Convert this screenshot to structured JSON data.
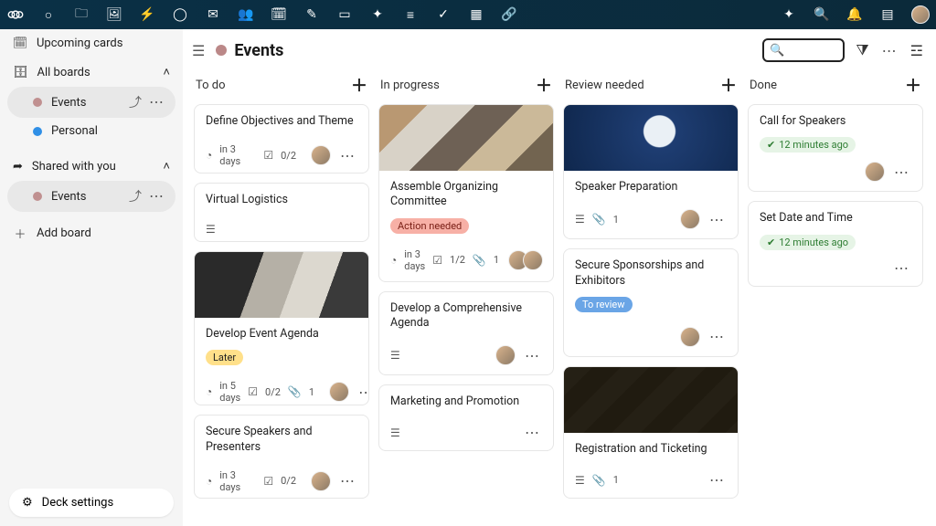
{
  "header": {
    "title": "Events"
  },
  "search": {
    "placeholder": ""
  },
  "sidebar": {
    "upcoming": "Upcoming cards",
    "all_boards": "All boards",
    "shared": "Shared with you",
    "add_board": "Add board",
    "deck_settings": "Deck settings",
    "boards": [
      {
        "name": "Events",
        "color": "#c09090"
      },
      {
        "name": "Personal",
        "color": "#2f8fe6"
      }
    ],
    "shared_boards": [
      {
        "name": "Events",
        "color": "#c09090"
      }
    ]
  },
  "lists": [
    {
      "name": "To do",
      "cards": [
        {
          "title": "Define Objectives and Theme",
          "due": "in 3 days",
          "checklist": "0/2",
          "avatar": true,
          "dots": true,
          "clock": true
        },
        {
          "title": "Virtual Logistics",
          "desc_icon": true
        },
        {
          "title": "Develop Event Agenda",
          "cover": "agenda",
          "label": "Later",
          "label_color": "yellow",
          "due": "in 5 days",
          "checklist": "0/2",
          "attachment": "1",
          "avatar": true,
          "dots": true,
          "clock": true
        },
        {
          "title": "Secure Speakers and Presenters",
          "due": "in 3 days",
          "checklist": "0/2",
          "avatar": true,
          "dots": true,
          "clock": true
        }
      ]
    },
    {
      "name": "In progress",
      "cards": [
        {
          "title": "Assemble Organizing Committee",
          "cover": "committee",
          "label": "Action needed",
          "label_color": "red",
          "due": "in 3 days",
          "checklist": "1/2",
          "attachment": "1",
          "avatars": 2,
          "dots": true,
          "clock": true
        },
        {
          "title": "Develop a Comprehensive Agenda",
          "desc_icon": true,
          "avatar": true,
          "dots": true
        },
        {
          "title": "Marketing and Promotion",
          "desc_icon": true,
          "dots": true
        }
      ]
    },
    {
      "name": "Review needed",
      "cards": [
        {
          "title": "Speaker Preparation",
          "cover": "speaker",
          "desc_icon": true,
          "attachment": "1",
          "avatar": true,
          "dots": true
        },
        {
          "title": "Secure Sponsorships and Exhibitors",
          "label": "To review",
          "label_color": "blue",
          "avatar": true,
          "dots": true
        },
        {
          "title": "Registration and Ticketing",
          "cover": "ticket",
          "desc_icon": true,
          "attachment": "1",
          "dots": true
        }
      ]
    },
    {
      "name": "Done",
      "cards": [
        {
          "title": "Call for Speakers",
          "done_time": "12 minutes ago",
          "avatar": true,
          "dots": true
        },
        {
          "title": "Set Date and Time",
          "done_time": "12 minutes ago",
          "dots": true
        }
      ]
    }
  ]
}
